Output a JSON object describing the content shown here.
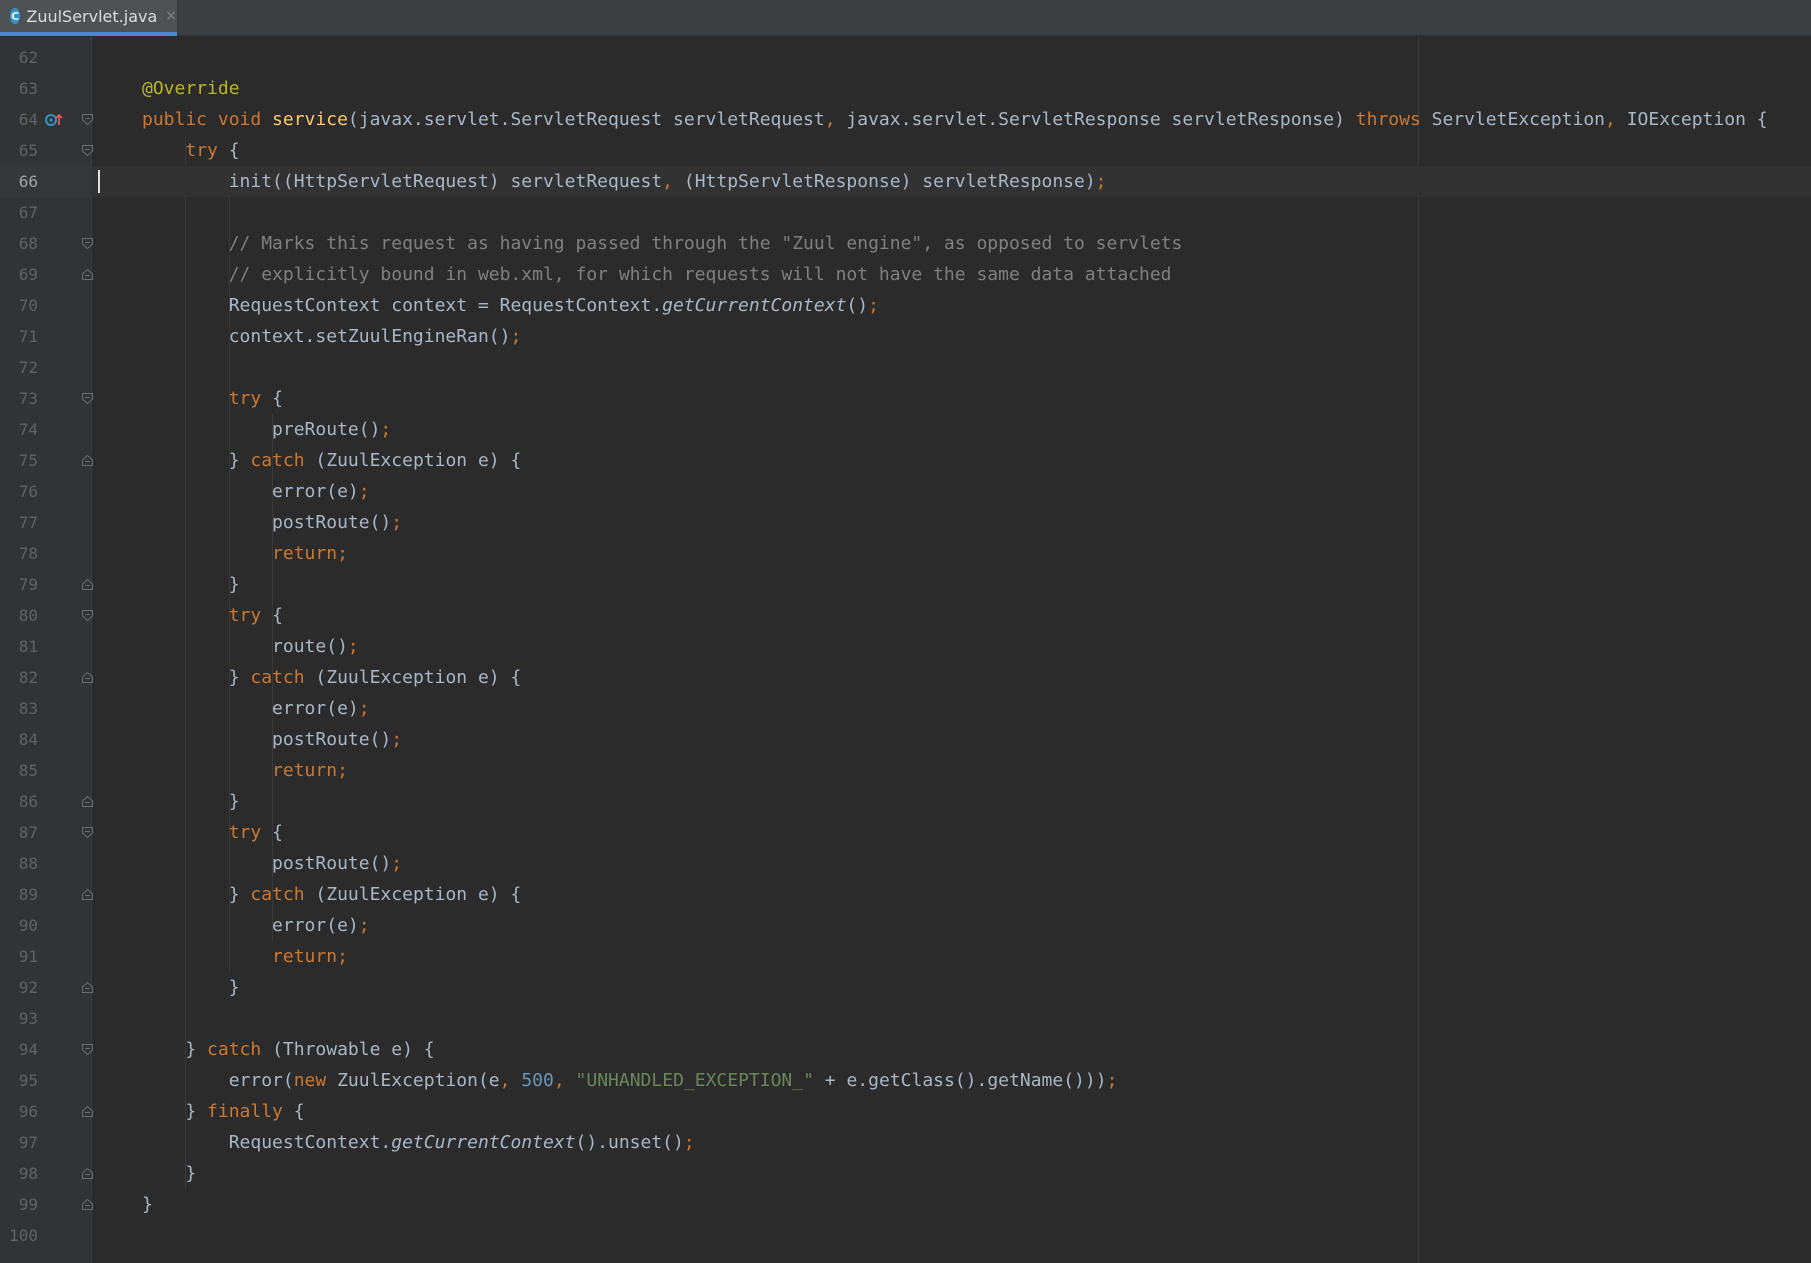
{
  "tab": {
    "icon": "class-icon",
    "icon_letter": "C",
    "label": "ZuulServlet.java",
    "close": "×"
  },
  "editor": {
    "current_line": 66,
    "lines": [
      {
        "n": "62",
        "fold": "",
        "tokens": []
      },
      {
        "n": "63",
        "fold": "",
        "tokens": [
          [
            "a",
            "@Override"
          ]
        ]
      },
      {
        "n": "64",
        "fold": "open",
        "override": true,
        "tokens": [
          [
            "k",
            "public void "
          ],
          [
            "m",
            "service"
          ],
          [
            "t",
            "(javax.servlet.ServletRequest servletRequest"
          ],
          [
            "p",
            ", "
          ],
          [
            "t",
            "javax.servlet.ServletResponse servletResponse) "
          ],
          [
            "k",
            "throws "
          ],
          [
            "t",
            "ServletException"
          ],
          [
            "p",
            ", "
          ],
          [
            "t",
            "IOException {"
          ]
        ]
      },
      {
        "n": "65",
        "fold": "open",
        "tokens": [
          [
            "t",
            "    "
          ],
          [
            "k",
            "try "
          ],
          [
            "t",
            "{"
          ]
        ]
      },
      {
        "n": "66",
        "fold": "",
        "tokens": [
          [
            "t",
            "        init((HttpServletRequest) servletRequest"
          ],
          [
            "p",
            ", "
          ],
          [
            "t",
            "(HttpServletResponse) servletResponse)"
          ],
          [
            "p",
            ";"
          ]
        ]
      },
      {
        "n": "67",
        "fold": "",
        "tokens": []
      },
      {
        "n": "68",
        "fold": "open",
        "tokens": [
          [
            "c",
            "        // Marks this request as having passed through the \"Zuul engine\", as opposed to servlets"
          ]
        ]
      },
      {
        "n": "69",
        "fold": "close",
        "tokens": [
          [
            "c",
            "        // explicitly bound in web.xml, for which requests will not have the same data attached"
          ]
        ]
      },
      {
        "n": "70",
        "fold": "",
        "tokens": [
          [
            "t",
            "        RequestContext context = RequestContext."
          ],
          [
            "i",
            "getCurrentContext"
          ],
          [
            "t",
            "()"
          ],
          [
            "p",
            ";"
          ]
        ]
      },
      {
        "n": "71",
        "fold": "",
        "tokens": [
          [
            "t",
            "        context.setZuulEngineRan()"
          ],
          [
            "p",
            ";"
          ]
        ]
      },
      {
        "n": "72",
        "fold": "",
        "tokens": []
      },
      {
        "n": "73",
        "fold": "open",
        "tokens": [
          [
            "t",
            "        "
          ],
          [
            "k",
            "try "
          ],
          [
            "t",
            "{"
          ]
        ]
      },
      {
        "n": "74",
        "fold": "",
        "tokens": [
          [
            "t",
            "            preRoute()"
          ],
          [
            "p",
            ";"
          ]
        ]
      },
      {
        "n": "75",
        "fold": "close",
        "tokens": [
          [
            "t",
            "        } "
          ],
          [
            "k",
            "catch "
          ],
          [
            "t",
            "(ZuulException e) {"
          ]
        ]
      },
      {
        "n": "76",
        "fold": "",
        "tokens": [
          [
            "t",
            "            error(e)"
          ],
          [
            "p",
            ";"
          ]
        ]
      },
      {
        "n": "77",
        "fold": "",
        "tokens": [
          [
            "t",
            "            postRoute()"
          ],
          [
            "p",
            ";"
          ]
        ]
      },
      {
        "n": "78",
        "fold": "",
        "tokens": [
          [
            "t",
            "            "
          ],
          [
            "k",
            "return;"
          ]
        ]
      },
      {
        "n": "79",
        "fold": "close",
        "tokens": [
          [
            "t",
            "        }"
          ]
        ]
      },
      {
        "n": "80",
        "fold": "open",
        "tokens": [
          [
            "t",
            "        "
          ],
          [
            "k",
            "try "
          ],
          [
            "t",
            "{"
          ]
        ]
      },
      {
        "n": "81",
        "fold": "",
        "tokens": [
          [
            "t",
            "            route()"
          ],
          [
            "p",
            ";"
          ]
        ]
      },
      {
        "n": "82",
        "fold": "close",
        "tokens": [
          [
            "t",
            "        } "
          ],
          [
            "k",
            "catch "
          ],
          [
            "t",
            "(ZuulException e) {"
          ]
        ]
      },
      {
        "n": "83",
        "fold": "",
        "tokens": [
          [
            "t",
            "            error(e)"
          ],
          [
            "p",
            ";"
          ]
        ]
      },
      {
        "n": "84",
        "fold": "",
        "tokens": [
          [
            "t",
            "            postRoute()"
          ],
          [
            "p",
            ";"
          ]
        ]
      },
      {
        "n": "85",
        "fold": "",
        "tokens": [
          [
            "t",
            "            "
          ],
          [
            "k",
            "return;"
          ]
        ]
      },
      {
        "n": "86",
        "fold": "close",
        "tokens": [
          [
            "t",
            "        }"
          ]
        ]
      },
      {
        "n": "87",
        "fold": "open",
        "tokens": [
          [
            "t",
            "        "
          ],
          [
            "k",
            "try "
          ],
          [
            "t",
            "{"
          ]
        ]
      },
      {
        "n": "88",
        "fold": "",
        "tokens": [
          [
            "t",
            "            postRoute()"
          ],
          [
            "p",
            ";"
          ]
        ]
      },
      {
        "n": "89",
        "fold": "close",
        "tokens": [
          [
            "t",
            "        } "
          ],
          [
            "k",
            "catch "
          ],
          [
            "t",
            "(ZuulException e) {"
          ]
        ]
      },
      {
        "n": "90",
        "fold": "",
        "tokens": [
          [
            "t",
            "            error(e)"
          ],
          [
            "p",
            ";"
          ]
        ]
      },
      {
        "n": "91",
        "fold": "",
        "tokens": [
          [
            "t",
            "            "
          ],
          [
            "k",
            "return;"
          ]
        ]
      },
      {
        "n": "92",
        "fold": "close",
        "tokens": [
          [
            "t",
            "        }"
          ]
        ]
      },
      {
        "n": "93",
        "fold": "",
        "tokens": []
      },
      {
        "n": "94",
        "fold": "open",
        "tokens": [
          [
            "t",
            "    } "
          ],
          [
            "k",
            "catch "
          ],
          [
            "t",
            "(Throwable e) {"
          ]
        ]
      },
      {
        "n": "95",
        "fold": "",
        "tokens": [
          [
            "t",
            "        error("
          ],
          [
            "k",
            "new "
          ],
          [
            "t",
            "ZuulException(e"
          ],
          [
            "p",
            ", "
          ],
          [
            "n",
            "500"
          ],
          [
            "p",
            ", "
          ],
          [
            "s",
            "\"UNHANDLED_EXCEPTION_\""
          ],
          [
            "t",
            " + e.getClass().getName()))"
          ],
          [
            "p",
            ";"
          ]
        ]
      },
      {
        "n": "96",
        "fold": "close",
        "tokens": [
          [
            "t",
            "    } "
          ],
          [
            "k",
            "finally "
          ],
          [
            "t",
            "{"
          ]
        ]
      },
      {
        "n": "97",
        "fold": "",
        "tokens": [
          [
            "t",
            "        RequestContext."
          ],
          [
            "i",
            "getCurrentContext"
          ],
          [
            "t",
            "().unset()"
          ],
          [
            "p",
            ";"
          ]
        ]
      },
      {
        "n": "98",
        "fold": "close",
        "tokens": [
          [
            "t",
            "    }"
          ]
        ]
      },
      {
        "n": "99",
        "fold": "close",
        "tokens": [
          [
            "t",
            "}"
          ]
        ]
      },
      {
        "n": "100",
        "fold": "",
        "tokens": []
      }
    ]
  },
  "colors": {
    "background": "#2b2b2b",
    "gutter": "#313335",
    "keyword": "#cc7832",
    "annotation": "#bbb529",
    "method": "#ffc66d",
    "comment": "#808080",
    "string": "#6a8759",
    "number": "#6897bb",
    "text": "#a9b7c6",
    "tab_accent": "#4a88c7"
  }
}
